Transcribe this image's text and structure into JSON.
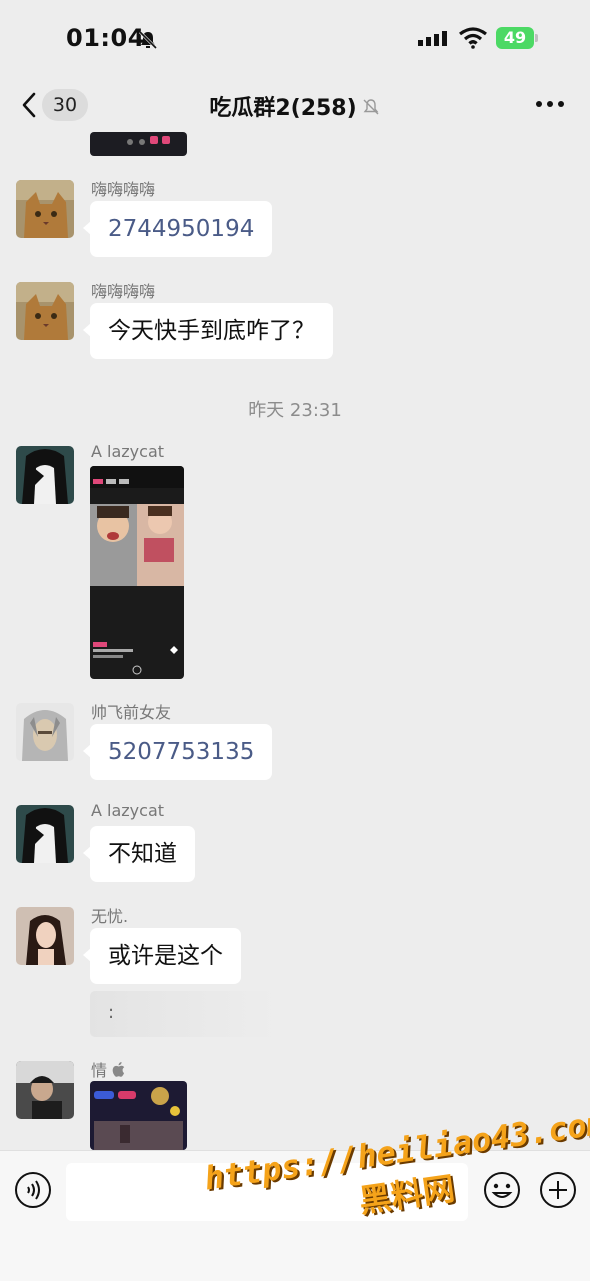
{
  "status_bar": {
    "time": "01:04",
    "battery": "49"
  },
  "nav": {
    "member_count_badge": "30",
    "title": "吃瓜群2(258)"
  },
  "messages": [
    {
      "sender": "嗨嗨嗨嗨",
      "text": "2744950194"
    },
    {
      "sender": "嗨嗨嗨嗨",
      "text": "今天快手到底咋了？"
    },
    {
      "sender": "A lazycat"
    },
    {
      "sender": "帅飞前女友",
      "text": "5207753135"
    },
    {
      "sender": "A lazycat",
      "text": "不知道"
    },
    {
      "sender": "无忧.",
      "text": "或许是这个"
    },
    {
      "sender": "情"
    }
  ],
  "timestamp": "昨天 23:31",
  "quote_text": ":",
  "screenshot_labels": {
    "time_a": "11:34",
    "time_b": "23:38"
  },
  "watermark": {
    "url": "https://heiliao43.com",
    "name": "黑料网"
  },
  "colors": {
    "background": "#ededed",
    "bubble": "#ffffff",
    "number_text": "#4a5b87",
    "battery": "#4cd964",
    "watermark": "#f5a31a"
  }
}
